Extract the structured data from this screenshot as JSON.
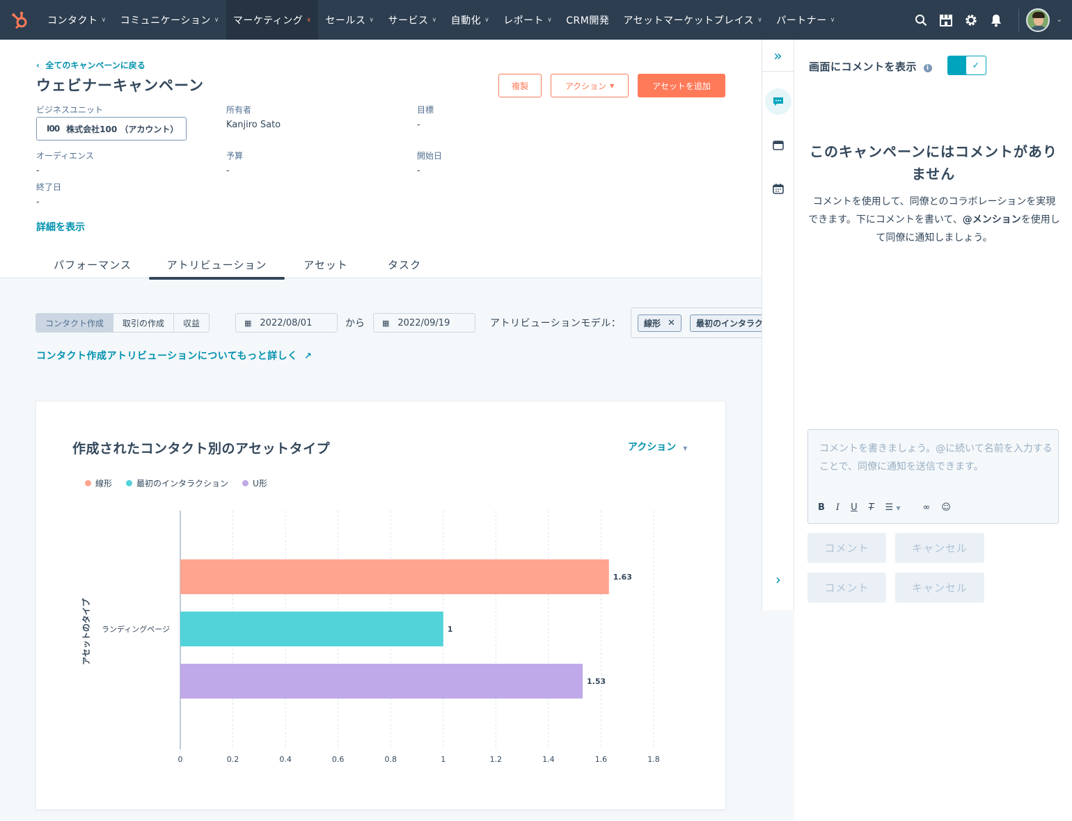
{
  "nav": {
    "items": [
      {
        "label": "コンタクト",
        "chevron": true
      },
      {
        "label": "コミュニケーション",
        "chevron": true
      },
      {
        "label": "マーケティング",
        "chevron": true,
        "active": true
      },
      {
        "label": "セールス",
        "chevron": true
      },
      {
        "label": "サービス",
        "chevron": true
      },
      {
        "label": "自動化",
        "chevron": true
      },
      {
        "label": "レポート",
        "chevron": true
      },
      {
        "label": "CRM開発",
        "chevron": false
      },
      {
        "label": "アセットマーケットプレイス",
        "chevron": true
      },
      {
        "label": "パートナー",
        "chevron": true
      }
    ],
    "icons": [
      "search-icon",
      "marketplace-icon",
      "gear-icon",
      "bell-icon"
    ]
  },
  "header": {
    "back_link": "全てのキャンペーンに戻る",
    "title": "ウェビナーキャンペーン",
    "buttons": {
      "duplicate": "複製",
      "actions": "アクション",
      "add_asset": "アセットを追加"
    },
    "fields": {
      "business_unit_label": "ビジネスユニット",
      "business_unit_value": "株式会社100 （アカウント）",
      "owner_label": "所有者",
      "owner_value": "Kanjiro Sato",
      "goal_label": "目標",
      "goal_value": "-",
      "audience_label": "オーディエンス",
      "audience_value": "-",
      "budget_label": "予算",
      "budget_value": "-",
      "start_label": "開始日",
      "start_value": "-",
      "end_label": "終了日",
      "end_value": "-"
    },
    "details_link": "詳細を表示",
    "tabs": [
      "パフォーマンス",
      "アトリビューション",
      "アセット",
      "タスク"
    ],
    "active_tab": 1
  },
  "filters": {
    "segments": [
      "コンタクト作成",
      "取引の作成",
      "収益"
    ],
    "active_segment": 0,
    "date_from": "2022/08/01",
    "from_word": "から",
    "date_to": "2022/09/19",
    "model_label": "アトリビューションモデル：",
    "model_chips": [
      "線形",
      "最初のインタラクション"
    ],
    "learn_more": "コンタクト作成アトリビューションについてもっと詳しく"
  },
  "chart_card": {
    "action": "アクション"
  },
  "chart_data": {
    "type": "bar",
    "orientation": "horizontal",
    "title": "作成されたコンタクト別のアセットタイプ",
    "categories": [
      "ランディングページ"
    ],
    "series": [
      {
        "name": "線形",
        "values": [
          1.63
        ],
        "color": "#ffa48f"
      },
      {
        "name": "最初のインタラクション",
        "values": [
          1
        ],
        "color": "#51d3d9"
      },
      {
        "name": "U形",
        "values": [
          1.53
        ],
        "color": "#bfa9e8"
      }
    ],
    "data_labels": [
      "1.63",
      "1",
      "1.53"
    ],
    "xlabel": "",
    "ylabel": "アセットのタイプ",
    "xlim": [
      0,
      1.8
    ],
    "xticks": [
      "0",
      "0.2",
      "0.4",
      "0.6",
      "0.8",
      "1",
      "1.2",
      "1.4",
      "1.6",
      "1.8"
    ],
    "grid": true,
    "legend": "top-left"
  },
  "comments": {
    "toggle_label": "画面にコメントを表示",
    "toggle_on": true,
    "empty_title": "このキャンペーンにはコメントがありません",
    "empty_body_1": "コメントを使用して、同僚とのコラボレーションを実現できます。下にコメントを書いて、",
    "empty_body_mention": "@メンション",
    "empty_body_2": "を使用して同僚に通知しましょう。",
    "placeholder": "コメントを書きましょう。@に続いて名前を入力することで、同僚に通知を送信できます。",
    "comment_button": "コメント",
    "cancel_button": "キャンセル"
  },
  "colors": {
    "nav_bg": "#2d3e50",
    "accent_orange": "#ff7a59",
    "link_teal": "#0091ae",
    "toggle_teal": "#00a4bd"
  }
}
